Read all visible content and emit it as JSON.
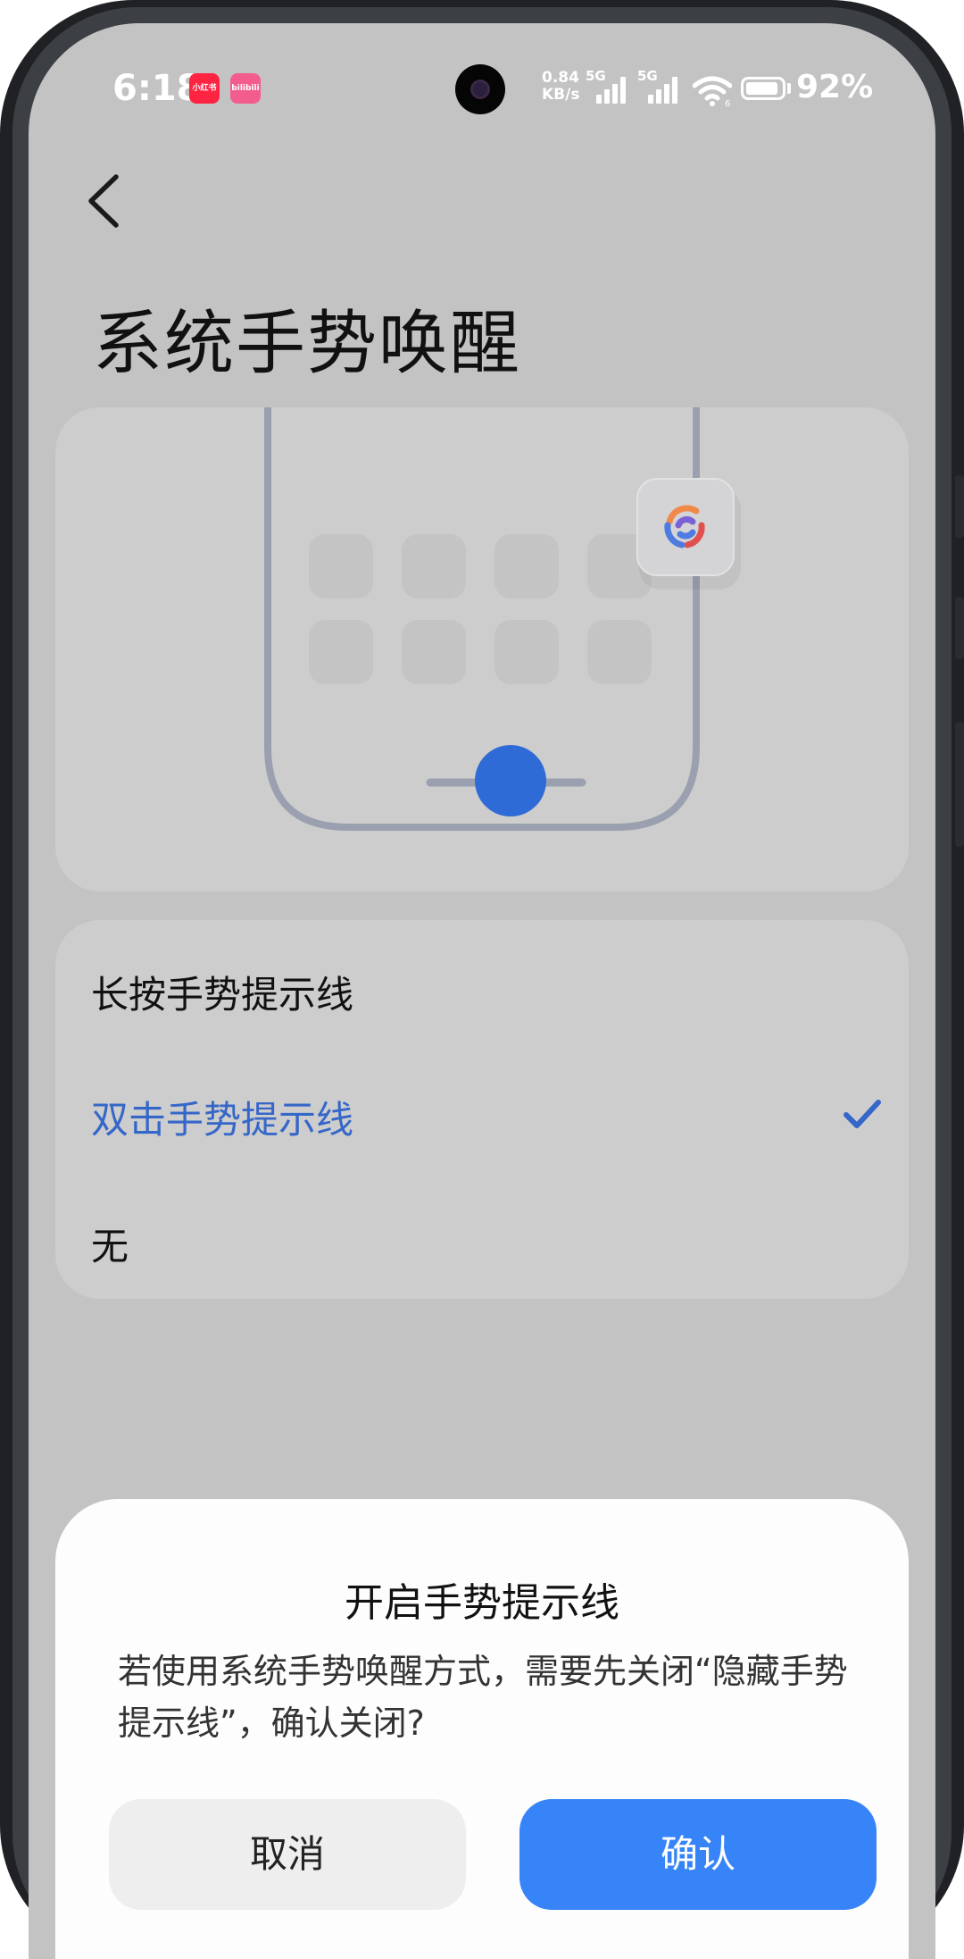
{
  "status_bar": {
    "time": "6:18",
    "app_icon_1_text": "小红书",
    "app_icon_2_text": "bilibili",
    "net_speed_value": "0.84",
    "net_speed_unit": "KB/s",
    "signal_1_label": "5G",
    "signal_2_label": "5G",
    "wifi_badge": "6",
    "battery_percent": "92%",
    "battery_level": 0.92
  },
  "header": {
    "back_icon": "chevron-left-icon",
    "title": "系统手势唤醒"
  },
  "illustration": {
    "assistant_icon": "ai-assistant-icon",
    "accent_color": "#2f6bd6"
  },
  "options": {
    "items": [
      {
        "label": "长按手势提示线",
        "selected": false
      },
      {
        "label": "双击手势提示线",
        "selected": true
      },
      {
        "label": "无",
        "selected": false
      }
    ],
    "selected_color": "#3567c9"
  },
  "dialog": {
    "title": "开启手势提示线",
    "message": "若使用系统手势唤醒方式，需要先关闭“隐藏手势提示线”，确认关闭?",
    "cancel_label": "取消",
    "confirm_label": "确认",
    "confirm_color": "#3784f8"
  }
}
